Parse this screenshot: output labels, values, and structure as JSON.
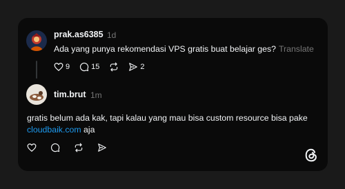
{
  "post": {
    "username": "prak.as6385",
    "timestamp": "1d",
    "text": "Ada yang punya rekomendasi VPS gratis buat belajar ges?",
    "translate_label": "Translate",
    "likes": "9",
    "replies": "15",
    "shares": "2"
  },
  "reply": {
    "username": "tim.brut",
    "timestamp": "1m",
    "text_line1": "gratis belum ada kak, tapi kalau yang mau bisa custom resource bisa pake",
    "link_text": "cloudbaik.com",
    "text_tail": " aja"
  },
  "icons": {
    "like": "heart-icon",
    "reply": "comment-icon",
    "repost": "repost-icon",
    "share": "send-icon",
    "brand": "threads-logo-icon"
  },
  "colors": {
    "background": "#1a1a1a",
    "card": "#0a0a0a",
    "text": "#f3f5f7",
    "muted": "#777777",
    "link": "#1d9bf0"
  }
}
